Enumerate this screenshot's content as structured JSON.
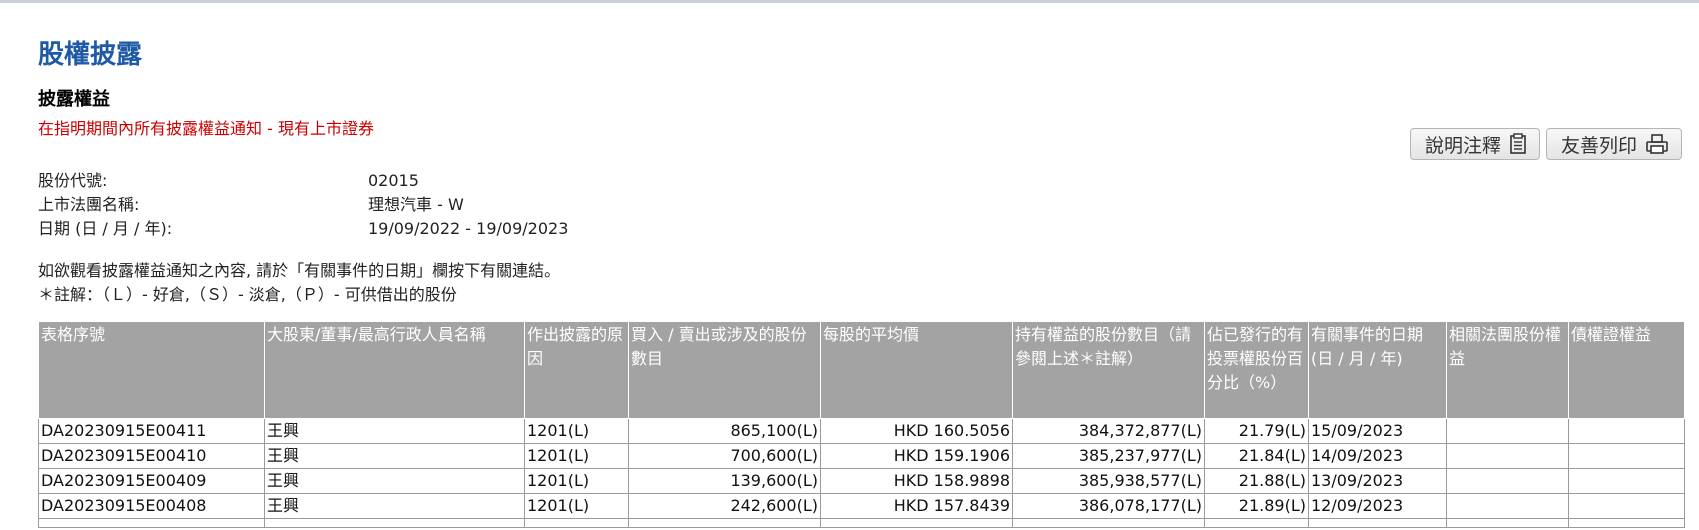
{
  "page_title": "股權披露",
  "section_title": "披露權益",
  "notice_subtitle": "在指明期間內所有披露權益通知 - 現有上市證券",
  "buttons": {
    "notes_label": "說明注釋",
    "print_label": "友善列印"
  },
  "meta": {
    "stock_code_label": "股份代號:",
    "stock_code_value": "02015",
    "company_label": "上市法團名稱:",
    "company_value": "理想汽車 - W",
    "date_label": "日期 (日 / 月 / 年):",
    "date_value": "19/09/2022 - 19/09/2023"
  },
  "hints": {
    "line1": "如欲觀看披露權益通知之內容, 請於「有關事件的日期」欄按下有關連結。",
    "line2": "＊註解：（Ｌ）- 好倉,（Ｓ）- 淡倉,（Ｐ）- 可供借出的股份"
  },
  "table": {
    "headers": [
      "表格序號",
      "大股東/董事/最高行政人員名稱",
      "作出披露的原因",
      "買入 / 賣出或涉及的股份數目",
      "每股的平均價",
      "持有權益的股份數目（請參閱上述＊註解）",
      "佔已發行的有投票權股份百分比（%）",
      "有關事件的日期 (日 / 月 / 年)",
      "相關法團股份權益",
      "債權證權益"
    ],
    "rows": [
      [
        "DA20230915E00411",
        "王興",
        "1201(L)",
        "865,100(L)",
        "HKD 160.5056",
        "384,372,877(L)",
        "21.79(L)",
        "15/09/2023",
        "",
        ""
      ],
      [
        "DA20230915E00410",
        "王興",
        "1201(L)",
        "700,600(L)",
        "HKD 159.1906",
        "385,237,977(L)",
        "21.84(L)",
        "14/09/2023",
        "",
        ""
      ],
      [
        "DA20230915E00409",
        "王興",
        "1201(L)",
        "139,600(L)",
        "HKD 158.9898",
        "385,938,577(L)",
        "21.88(L)",
        "13/09/2023",
        "",
        ""
      ],
      [
        "DA20230915E00408",
        "王興",
        "1201(L)",
        "242,600(L)",
        "HKD 157.8439",
        "386,078,177(L)",
        "21.89(L)",
        "12/09/2023",
        "",
        ""
      ]
    ]
  }
}
